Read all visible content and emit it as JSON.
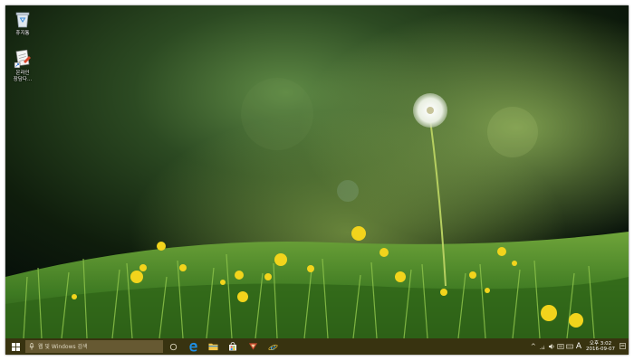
{
  "desktop": {
    "icons": [
      {
        "label": "휴지통",
        "icon": "recycle-bin-icon"
      },
      {
        "label": "온라인\n장담다...",
        "icon": "document-shortcut-icon"
      }
    ]
  },
  "taskbar": {
    "search_placeholder": "웹 및 Windows 검색",
    "pinned": [
      "task-view-icon",
      "edge-icon",
      "file-explorer-icon",
      "store-icon",
      "app-icon",
      "internet-explorer-icon"
    ],
    "tray": {
      "ime": "A",
      "time": "오후 3:02",
      "date": "2016-09-07"
    }
  },
  "colors": {
    "taskbar": "#3a3010",
    "search_box": "#6e6038",
    "edge_blue": "#1e90e8"
  }
}
